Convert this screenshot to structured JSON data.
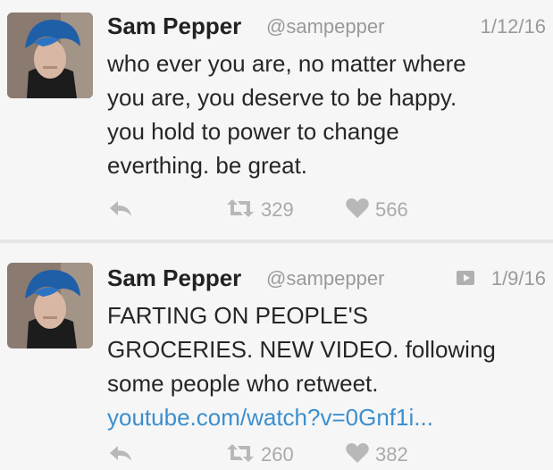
{
  "tweets": [
    {
      "author": "Sam Pepper",
      "handle": "@sampepper",
      "date": "1/12/16",
      "text_lines": [
        "who ever you are, no matter where",
        "you are, you deserve to be happy.",
        "you hold to power to change",
        "everthing. be great."
      ],
      "link": "",
      "retweets": "329",
      "likes": "566",
      "has_video": false
    },
    {
      "author": "Sam Pepper",
      "handle": "@sampepper",
      "date": "1/9/16",
      "text_lines": [
        "FARTING ON PEOPLE'S",
        "GROCERIES. NEW VIDEO. following",
        "some people who retweet."
      ],
      "link": "youtube.com/watch?v=0Gnf1i...",
      "retweets": "260",
      "likes": "382",
      "has_video": true
    }
  ],
  "colors": {
    "link": "#3b8fce",
    "muted": "#9a9a9a",
    "icon": "#b8b8b8",
    "background": "#f6f6f6"
  },
  "icons": {
    "reply": "reply-icon",
    "retweet": "retweet-icon",
    "like": "heart-icon",
    "video": "video-icon"
  }
}
